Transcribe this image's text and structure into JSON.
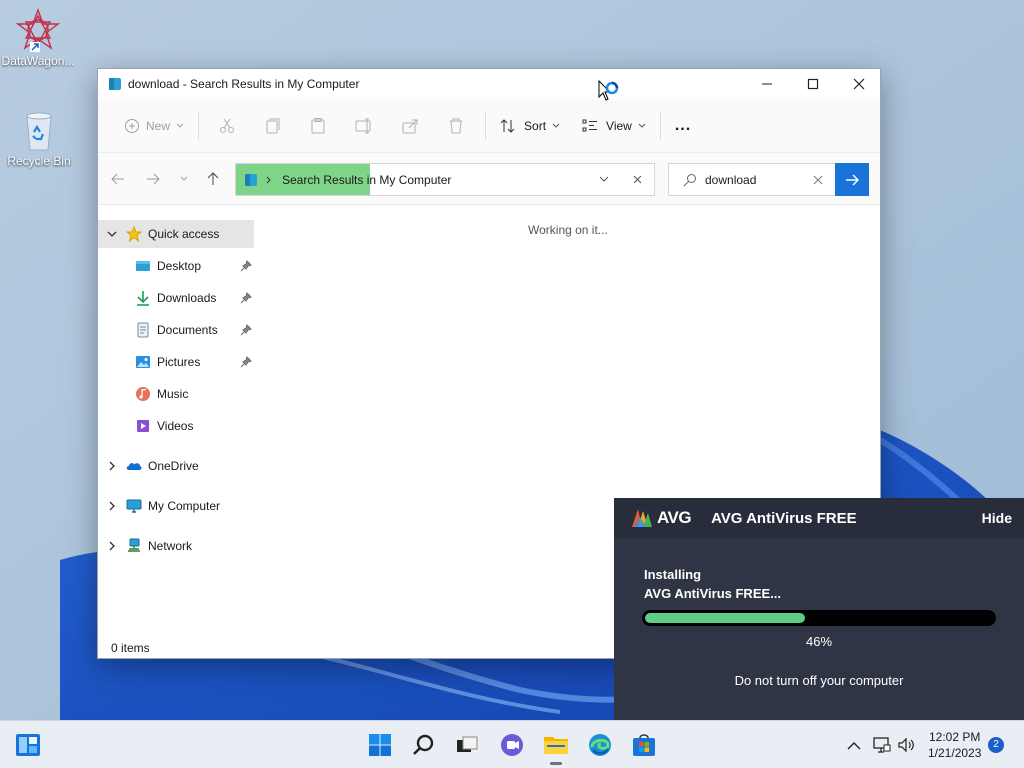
{
  "desktop": {
    "icons": [
      {
        "label": "DataWagon...",
        "icon": "datawagon-icon"
      },
      {
        "label": "Recycle Bin",
        "icon": "recycle-bin-icon"
      }
    ]
  },
  "explorer": {
    "title": "download - Search Results in My Computer",
    "toolbar": {
      "new_label": "New",
      "sort_label": "Sort",
      "view_label": "View",
      "more_label": "..."
    },
    "address": {
      "crumb": "Search Results in My Computer",
      "progress": 0.32
    },
    "search": {
      "value": "download"
    },
    "sidebar": {
      "quick_access": "Quick access",
      "items": [
        {
          "label": "Desktop",
          "icon": "desktop-icon",
          "pinned": true
        },
        {
          "label": "Downloads",
          "icon": "downloads-icon",
          "pinned": true
        },
        {
          "label": "Documents",
          "icon": "documents-icon",
          "pinned": true
        },
        {
          "label": "Pictures",
          "icon": "pictures-icon",
          "pinned": true
        },
        {
          "label": "Music",
          "icon": "music-icon",
          "pinned": false
        },
        {
          "label": "Videos",
          "icon": "videos-icon",
          "pinned": false
        }
      ],
      "onedrive": "OneDrive",
      "my_computer": "My Computer",
      "network": "Network"
    },
    "content": {
      "status_text": "Working on it..."
    },
    "statusbar": {
      "items": "0 items"
    }
  },
  "avg": {
    "logo": "AVG",
    "app_name": "AVG AntiVirus FREE",
    "hide_label": "Hide",
    "status_line1": "Installing",
    "status_line2": "AVG AntiVirus FREE...",
    "progress_value": 0.46,
    "progress_text": "46%",
    "warning": "Do not turn off your computer",
    "colors": {
      "bg": "#2f3545",
      "bar": "#5dcd88"
    }
  },
  "taskbar": {
    "time": "12:02 PM",
    "date": "1/21/2023",
    "notifications": "2"
  }
}
